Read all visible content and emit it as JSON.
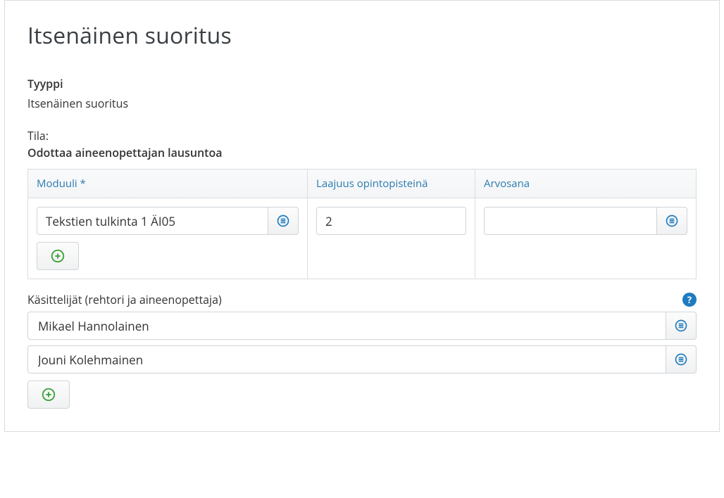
{
  "title": "Itsenäinen suoritus",
  "type_label": "Tyyppi",
  "type_value": "Itsenäinen suoritus",
  "status_label": "Tila:",
  "status_value": "Odottaa aineenopettajan lausuntoa",
  "columns": {
    "module": "Moduuli *",
    "credits": "Laajuus opintopisteinä",
    "grade": "Arvosana"
  },
  "rows": [
    {
      "module": "Tekstien tulkinta 1 ÄI05",
      "credits": "2",
      "grade": ""
    }
  ],
  "handlers_label": "Käsittelijät (rehtori ja aineenopettaja)",
  "handlers": [
    "Mikael Hannolainen",
    "Jouni Kolehmainen"
  ],
  "icons": {
    "picker": "list-circle",
    "add": "plus-circle",
    "help": "?"
  },
  "colors": {
    "link_blue": "#2a7ab0",
    "help_blue": "#1e7bbf",
    "plus_green": "#3aa03a"
  }
}
